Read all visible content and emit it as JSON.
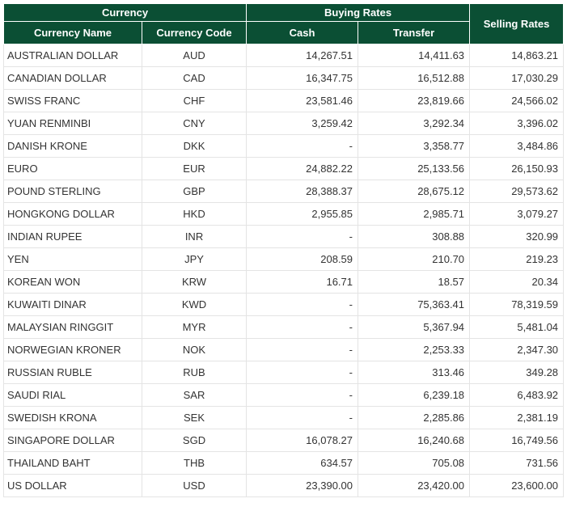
{
  "header": {
    "currency": "Currency",
    "buying_rates": "Buying Rates",
    "selling_rates": "Selling Rates",
    "currency_name": "Currency Name",
    "currency_code": "Currency Code",
    "cash": "Cash",
    "transfer": "Transfer"
  },
  "rows": [
    {
      "name": "AUSTRALIAN DOLLAR",
      "code": "AUD",
      "cash": "14,267.51",
      "transfer": "14,411.63",
      "selling": "14,863.21"
    },
    {
      "name": "CANADIAN DOLLAR",
      "code": "CAD",
      "cash": "16,347.75",
      "transfer": "16,512.88",
      "selling": "17,030.29"
    },
    {
      "name": "SWISS FRANC",
      "code": "CHF",
      "cash": "23,581.46",
      "transfer": "23,819.66",
      "selling": "24,566.02"
    },
    {
      "name": "YUAN RENMINBI",
      "code": "CNY",
      "cash": "3,259.42",
      "transfer": "3,292.34",
      "selling": "3,396.02"
    },
    {
      "name": "DANISH KRONE",
      "code": "DKK",
      "cash": "-",
      "transfer": "3,358.77",
      "selling": "3,484.86"
    },
    {
      "name": "EURO",
      "code": "EUR",
      "cash": "24,882.22",
      "transfer": "25,133.56",
      "selling": "26,150.93"
    },
    {
      "name": "POUND STERLING",
      "code": "GBP",
      "cash": "28,388.37",
      "transfer": "28,675.12",
      "selling": "29,573.62"
    },
    {
      "name": "HONGKONG DOLLAR",
      "code": "HKD",
      "cash": "2,955.85",
      "transfer": "2,985.71",
      "selling": "3,079.27"
    },
    {
      "name": "INDIAN RUPEE",
      "code": "INR",
      "cash": "-",
      "transfer": "308.88",
      "selling": "320.99"
    },
    {
      "name": "YEN",
      "code": "JPY",
      "cash": "208.59",
      "transfer": "210.70",
      "selling": "219.23"
    },
    {
      "name": "KOREAN WON",
      "code": "KRW",
      "cash": "16.71",
      "transfer": "18.57",
      "selling": "20.34"
    },
    {
      "name": "KUWAITI DINAR",
      "code": "KWD",
      "cash": "-",
      "transfer": "75,363.41",
      "selling": "78,319.59"
    },
    {
      "name": "MALAYSIAN RINGGIT",
      "code": "MYR",
      "cash": "-",
      "transfer": "5,367.94",
      "selling": "5,481.04"
    },
    {
      "name": "NORWEGIAN KRONER",
      "code": "NOK",
      "cash": "-",
      "transfer": "2,253.33",
      "selling": "2,347.30"
    },
    {
      "name": "RUSSIAN RUBLE",
      "code": "RUB",
      "cash": "-",
      "transfer": "313.46",
      "selling": "349.28"
    },
    {
      "name": "SAUDI RIAL",
      "code": "SAR",
      "cash": "-",
      "transfer": "6,239.18",
      "selling": "6,483.92"
    },
    {
      "name": "SWEDISH KRONA",
      "code": "SEK",
      "cash": "-",
      "transfer": "2,285.86",
      "selling": "2,381.19"
    },
    {
      "name": "SINGAPORE DOLLAR",
      "code": "SGD",
      "cash": "16,078.27",
      "transfer": "16,240.68",
      "selling": "16,749.56"
    },
    {
      "name": "THAILAND BAHT",
      "code": "THB",
      "cash": "634.57",
      "transfer": "705.08",
      "selling": "731.56"
    },
    {
      "name": "US DOLLAR",
      "code": "USD",
      "cash": "23,390.00",
      "transfer": "23,420.00",
      "selling": "23,600.00"
    }
  ]
}
